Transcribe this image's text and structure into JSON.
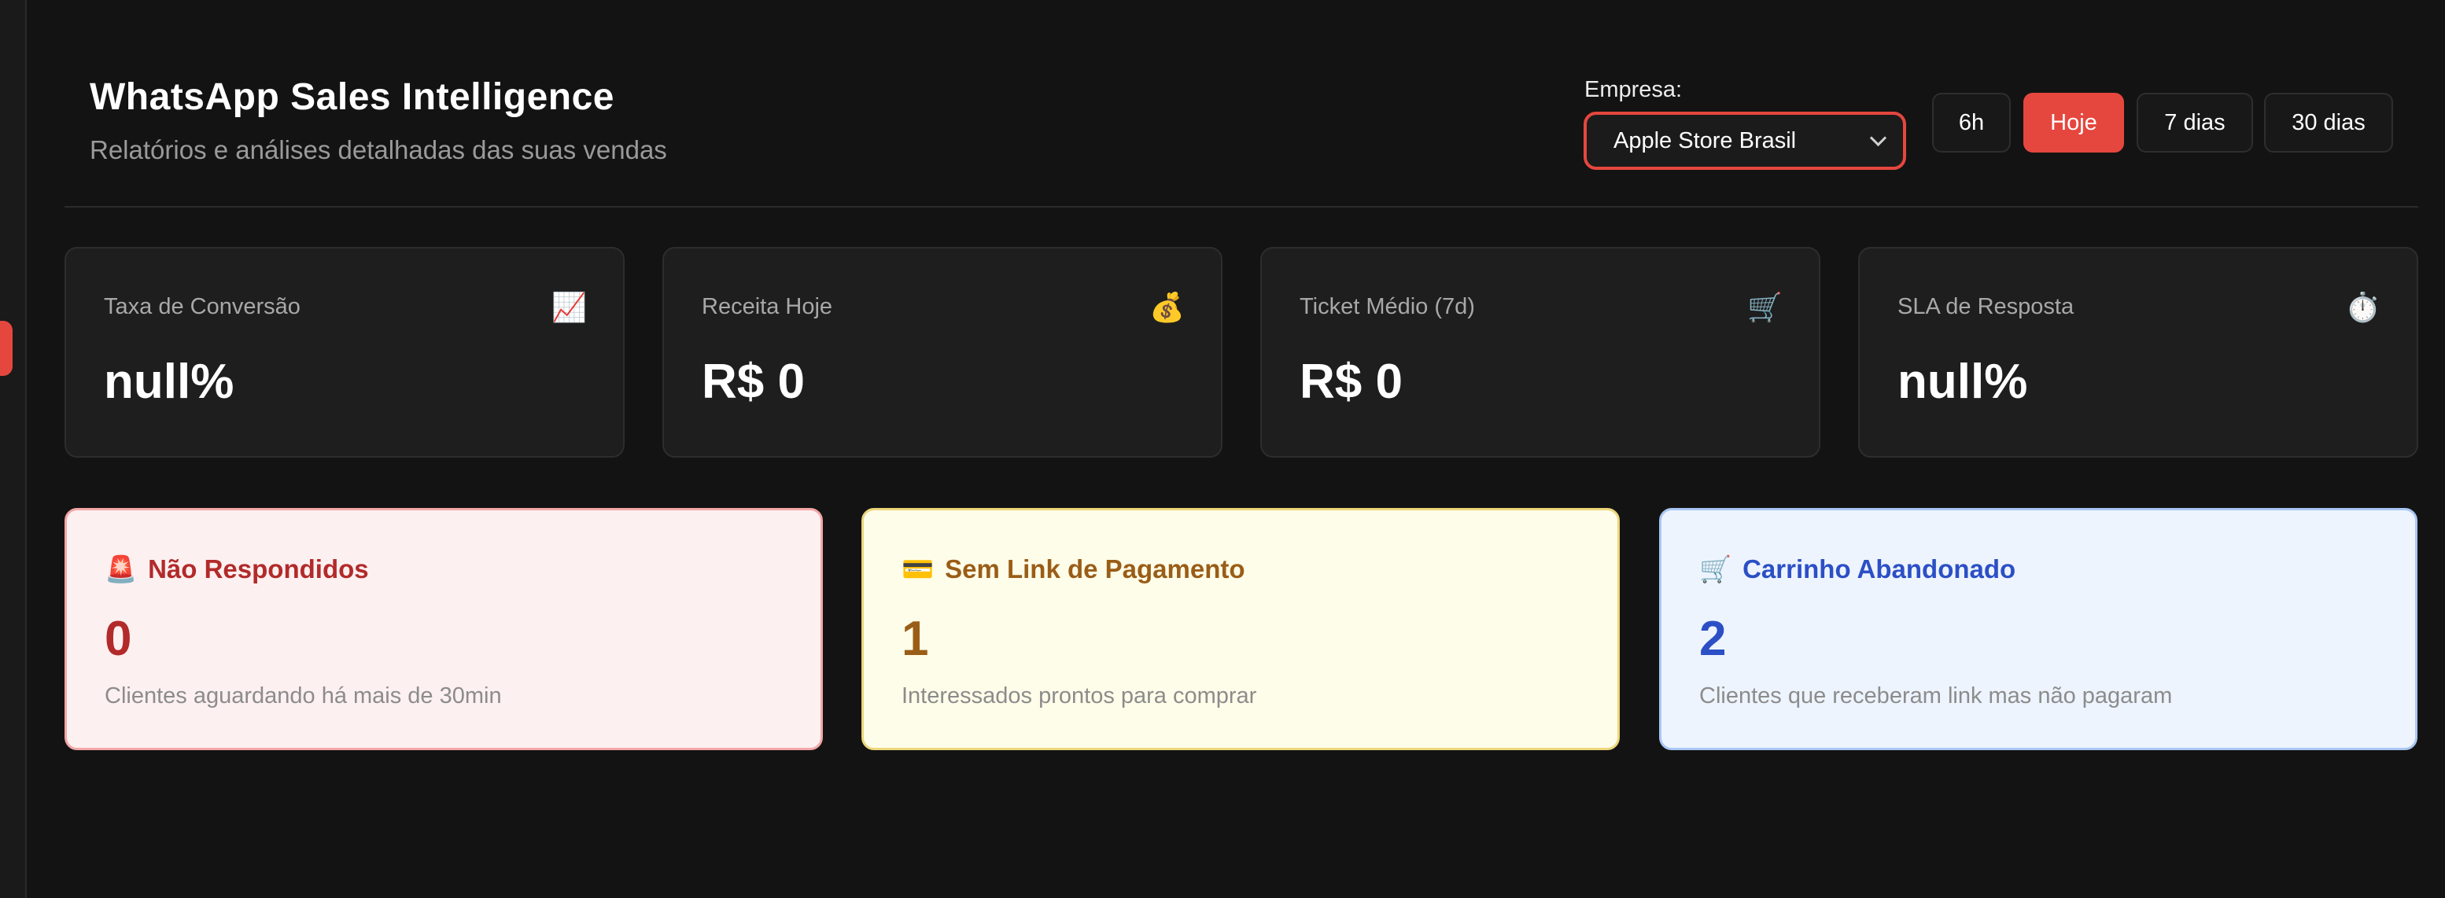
{
  "header": {
    "title": "WhatsApp Sales Intelligence",
    "subtitle": "Relatórios e análises detalhadas das suas vendas"
  },
  "filters": {
    "company_label": "Empresa:",
    "company_selected": "Apple Store Brasil",
    "time_ranges": [
      {
        "label": "6h",
        "active": false
      },
      {
        "label": "Hoje",
        "active": true
      },
      {
        "label": "7 dias",
        "active": false
      },
      {
        "label": "30 dias",
        "active": false
      }
    ],
    "accent_color": "#e5473e"
  },
  "stats": [
    {
      "label": "Taxa de Conversão",
      "icon": "chart-increasing-icon",
      "glyph": "📈",
      "value": "null%"
    },
    {
      "label": "Receita Hoje",
      "icon": "money-bag-icon",
      "glyph": "💰",
      "value": "R$ 0"
    },
    {
      "label": "Ticket Médio (7d)",
      "icon": "shopping-cart-icon",
      "glyph": "🛒",
      "value": "R$ 0"
    },
    {
      "label": "SLA de Resposta",
      "icon": "stopwatch-icon",
      "glyph": "⏱️",
      "value": "null%"
    }
  ],
  "alerts": [
    {
      "emoji": "🚨",
      "icon": "siren-icon",
      "title": "Não Respondidos",
      "value": "0",
      "description": "Clientes aguardando há mais de 30min",
      "color": "#b22a2a"
    },
    {
      "emoji": "💳",
      "icon": "credit-card-icon",
      "title": "Sem Link de Pagamento",
      "value": "1",
      "description": "Interessados prontos para comprar",
      "color": "#9a5d17"
    },
    {
      "emoji": "🛒",
      "icon": "shopping-cart-icon",
      "title": "Carrinho Abandonado",
      "value": "2",
      "description": "Clientes que receberam link mas não pagaram",
      "color": "#2c4fc6"
    }
  ]
}
